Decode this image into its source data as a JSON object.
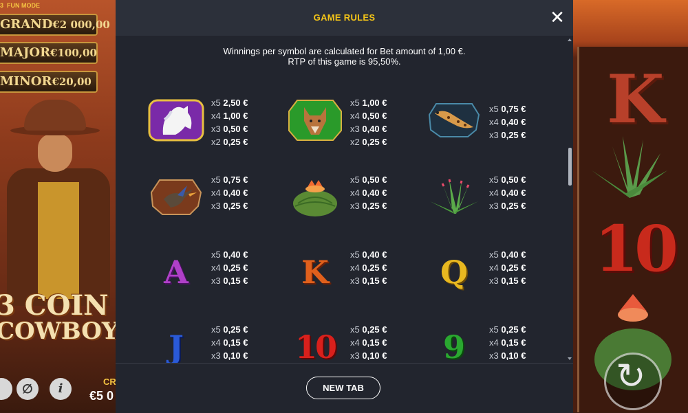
{
  "background": {
    "mode_label": "FUN MODE",
    "mode_prefix": "3",
    "jackpots": [
      {
        "label": "GRAND",
        "amount": "€2 000,00"
      },
      {
        "label": "MAJOR",
        "amount": "€100,00"
      },
      {
        "label": "MINOR",
        "amount": "€20,00"
      }
    ],
    "logo_line1": "3 COIN",
    "logo_line2": "COWBOY",
    "credit_label": "CR",
    "credit_value": "€5 0",
    "reel_symbols": [
      "K",
      "10"
    ]
  },
  "modal": {
    "title": "GAME RULES",
    "close_icon": "close-icon",
    "intro_line1": "Winnings per symbol are calculated for Bet amount of 1,00 €.",
    "intro_line2": "RTP of this game is 95,50%.",
    "new_tab_label": "NEW TAB"
  },
  "symbols": [
    {
      "name": "white-horse",
      "pays": [
        {
          "m": "x5",
          "v": "2,50 €"
        },
        {
          "m": "x4",
          "v": "1,00 €"
        },
        {
          "m": "x3",
          "v": "0,50 €"
        },
        {
          "m": "x2",
          "v": "0,25 €"
        }
      ]
    },
    {
      "name": "coyote",
      "pays": [
        {
          "m": "x5",
          "v": "1,00 €"
        },
        {
          "m": "x4",
          "v": "0,50 €"
        },
        {
          "m": "x3",
          "v": "0,40 €"
        },
        {
          "m": "x2",
          "v": "0,25 €"
        }
      ]
    },
    {
      "name": "lizard",
      "pays": [
        {
          "m": "x5",
          "v": "0,75 €"
        },
        {
          "m": "x4",
          "v": "0,40 €"
        },
        {
          "m": "x3",
          "v": "0,25 €"
        }
      ]
    },
    {
      "name": "roadrunner",
      "pays": [
        {
          "m": "x5",
          "v": "0,75 €"
        },
        {
          "m": "x4",
          "v": "0,40 €"
        },
        {
          "m": "x3",
          "v": "0,25 €"
        }
      ]
    },
    {
      "name": "barrel-cactus",
      "pays": [
        {
          "m": "x5",
          "v": "0,50 €"
        },
        {
          "m": "x4",
          "v": "0,40 €"
        },
        {
          "m": "x3",
          "v": "0,25 €"
        }
      ]
    },
    {
      "name": "agave",
      "pays": [
        {
          "m": "x5",
          "v": "0,50 €"
        },
        {
          "m": "x4",
          "v": "0,40 €"
        },
        {
          "m": "x3",
          "v": "0,25 €"
        }
      ]
    },
    {
      "name": "letter-a",
      "text": "A",
      "color": "#b040c8",
      "pays": [
        {
          "m": "x5",
          "v": "0,40 €"
        },
        {
          "m": "x4",
          "v": "0,25 €"
        },
        {
          "m": "x3",
          "v": "0,15 €"
        }
      ]
    },
    {
      "name": "letter-k",
      "text": "K",
      "color": "#e0601c",
      "pays": [
        {
          "m": "x5",
          "v": "0,40 €"
        },
        {
          "m": "x4",
          "v": "0,25 €"
        },
        {
          "m": "x3",
          "v": "0,15 €"
        }
      ]
    },
    {
      "name": "letter-q",
      "text": "Q",
      "color": "#e8b820",
      "pays": [
        {
          "m": "x5",
          "v": "0,40 €"
        },
        {
          "m": "x4",
          "v": "0,25 €"
        },
        {
          "m": "x3",
          "v": "0,15 €"
        }
      ]
    },
    {
      "name": "letter-j",
      "text": "J",
      "color": "#2a5ad8",
      "pays": [
        {
          "m": "x5",
          "v": "0,25 €"
        },
        {
          "m": "x4",
          "v": "0,15 €"
        },
        {
          "m": "x3",
          "v": "0,10 €"
        }
      ]
    },
    {
      "name": "number-10",
      "text": "10",
      "color": "#d8201c",
      "pays": [
        {
          "m": "x5",
          "v": "0,25 €"
        },
        {
          "m": "x4",
          "v": "0,15 €"
        },
        {
          "m": "x3",
          "v": "0,10 €"
        }
      ]
    },
    {
      "name": "number-9",
      "text": "9",
      "color": "#2aa830",
      "pays": [
        {
          "m": "x5",
          "v": "0,25 €"
        },
        {
          "m": "x4",
          "v": "0,15 €"
        },
        {
          "m": "x3",
          "v": "0,10 €"
        }
      ]
    }
  ]
}
